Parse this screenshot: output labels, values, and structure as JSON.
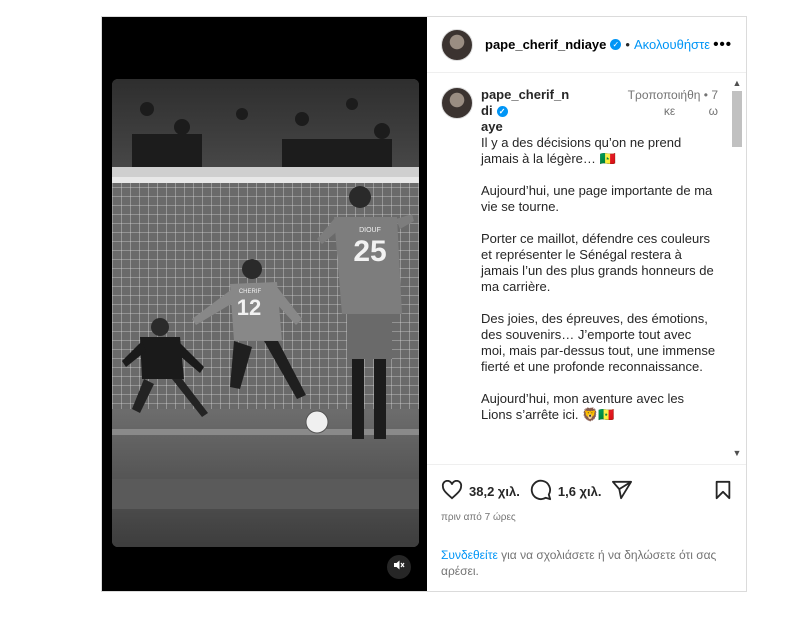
{
  "header": {
    "username": "pape_cherif_ndiaye",
    "separator": "•",
    "follow_label": "Ακολουθήστε",
    "more_label": "•••"
  },
  "caption": {
    "username_line1": "pape_cherif_ndi",
    "username_line2": "aye",
    "edited_label_1": "Τροποποιήθη",
    "edited_label_2": "κε",
    "dot": "•",
    "age_1": "7",
    "age_2": "ω",
    "paragraphs": [
      "Il y a des décisions qu’on ne prend jamais à la légère… 🇸🇳",
      "Aujourd’hui, une page importante de ma vie se tourne.",
      "Porter ce maillot, défendre ces couleurs et représenter le Sénégal restera à jamais l’un des plus grands honneurs de ma carrière.",
      "Des joies, des épreuves, des émotions, des souvenirs… J’emporte tout avec moi, mais par-dessus tout, une immense fierté et une profonde reconnaissance.",
      "Aujourd’hui, mon aventure avec les Lions s’arrête ici. 🦁🇸🇳"
    ]
  },
  "actions": {
    "likes": "38,2 χιλ.",
    "comments": "1,6 χιλ."
  },
  "time_ago": "πριν από 7 ώρες",
  "login_prompt": {
    "link": "Συνδεθείτε",
    "rest": " για να σχολιάσετε ή να δηλώσετε ότι σας αρέσει."
  },
  "media": {
    "jersey_left_name": "CHERIF",
    "jersey_left_number": "12",
    "jersey_right_name": "DIOUF",
    "jersey_right_number": "25"
  },
  "icons": [
    "heart-icon",
    "comment-icon",
    "share-icon",
    "bookmark-icon",
    "mute-icon",
    "verified-icon"
  ],
  "colors": {
    "accent": "#0095f6",
    "muted": "#737373",
    "border": "#dbdbdb"
  }
}
